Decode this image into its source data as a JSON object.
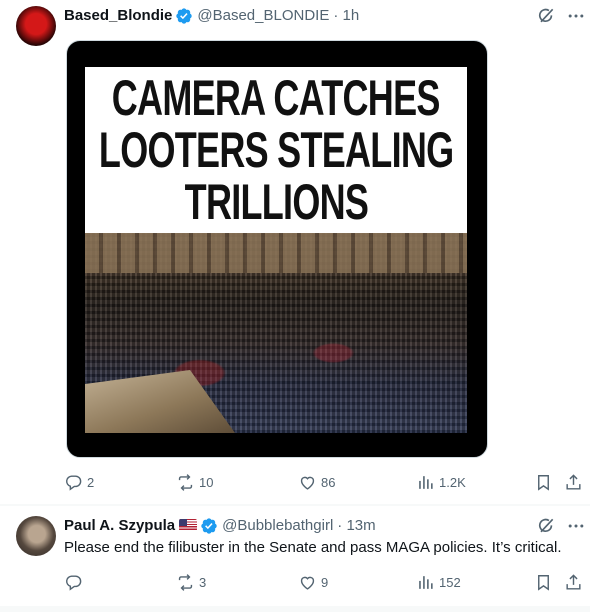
{
  "posts": [
    {
      "display_name": "Based_Blondie",
      "handle": "@Based_BLONDIE",
      "time": "· 1h",
      "media": {
        "headline_lines": [
          "CAMERA CATCHES",
          "LOOTERS STEALING",
          "TRILLIONS"
        ]
      },
      "stats": {
        "replies": "2",
        "reposts": "10",
        "likes": "86",
        "views": "1.2K"
      }
    },
    {
      "display_name": "Paul A. Szypula",
      "handle": "@Bubblebathgirl",
      "time": "· 13m",
      "text": "Please end the filibuster in the Senate and pass MAGA policies. It’s critical.",
      "stats": {
        "replies": "",
        "reposts": "3",
        "likes": "9",
        "views": "152"
      }
    }
  ],
  "colors": {
    "verified": "#1d9bf0",
    "muted": "#536471",
    "text": "#0f1419"
  }
}
